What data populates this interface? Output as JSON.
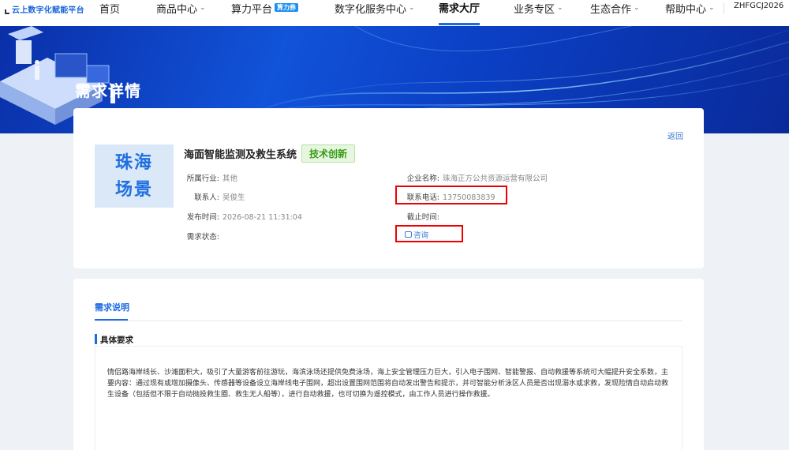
{
  "nav": {
    "logo_text": "云上数字化赋能平台",
    "items": [
      {
        "label": "首页",
        "has_chevron": false
      },
      {
        "label": "商品中心",
        "has_chevron": true
      },
      {
        "label": "算力平台",
        "has_chevron": false,
        "tag": "算力券"
      },
      {
        "label": "数字化服务中心",
        "has_chevron": true
      },
      {
        "label": "需求大厅",
        "has_chevron": false,
        "active": true
      },
      {
        "label": "业务专区",
        "has_chevron": true
      },
      {
        "label": "生态合作",
        "has_chevron": true
      },
      {
        "label": "帮助中心",
        "has_chevron": true
      }
    ],
    "user": "ZHFGCJ2026"
  },
  "banner": {
    "title": "需求详情"
  },
  "detail": {
    "back_label": "返回",
    "thumb_line1": "珠海",
    "thumb_line2": "场景",
    "title": "海面智能监测及救生系统",
    "badge": "技术创新",
    "industry_label": "所属行业:",
    "industry_value": "其他",
    "contact_label": "联系人:",
    "contact_value": "吴俊生",
    "publish_label": "发布时间:",
    "publish_value": "2026-08-21 11:31:04",
    "status_label": "需求状态:",
    "status_value": "",
    "company_label": "企业名称:",
    "company_value": "珠海正方公共资源运营有限公司",
    "phone_label": "联系电话:",
    "phone_value": "13750083839",
    "deadline_label": "截止时间:",
    "deadline_value": "",
    "consult_label": "咨询"
  },
  "description": {
    "tab_label": "需求说明",
    "section_title": "具体要求",
    "text": "情侣路海岸线长、沙滩面积大，吸引了大量游客前往游玩，海滨泳场还提供免费泳场，海上安全管理压力巨大，引入电子围网、智能警报、自动救援等系统可大幅提升安全系数，主要内容：通过现有或增加摄像头、传感器等设备设立海岸线电子围网，超出设置围网范围将自动发出警告和提示，并可智能分析泳区人员是否出现溺水或求救，发现险情自动启动救生设备（包括但不限于自动抛投救生圈、救生无人船等），进行自动救援，也可切换为遥控模式，由工作人员进行操作救援。"
  },
  "colors": {
    "accent": "#1d6ae5",
    "badge_green": "#3a9b1c",
    "highlight_red": "#e00000"
  }
}
